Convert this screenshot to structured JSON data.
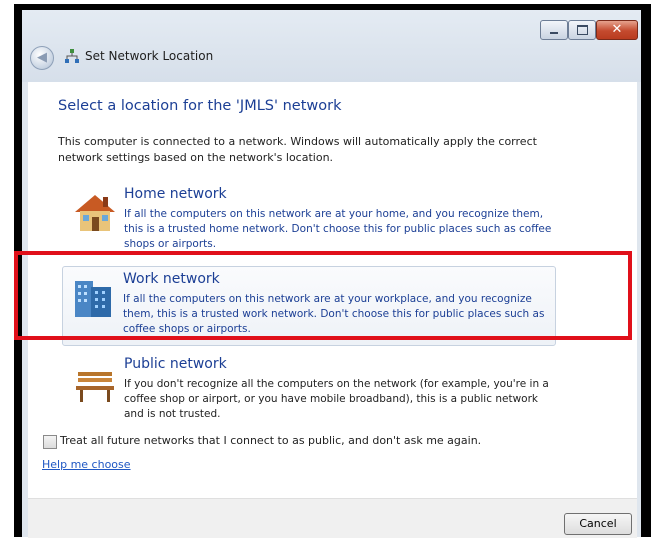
{
  "window": {
    "title": "Set Network Location",
    "controls": {
      "minimize_icon": "minimize-icon",
      "maximize_icon": "maximize-icon",
      "close_icon": "close-icon"
    }
  },
  "main": {
    "heading": "Select a location for the 'JMLS' network",
    "intro": "This computer is connected to a network. Windows will automatically apply the correct network settings based on the network's location.",
    "options": [
      {
        "title": "Home network",
        "description": "If all the computers on this network are at your home, and you recognize them, this is a trusted home network.  Don't choose this for public places such as coffee shops or airports.",
        "icon": "house-icon"
      },
      {
        "title": "Work network",
        "description": "If all the computers on this network are at your workplace, and you recognize them, this is a trusted work network.  Don't choose this for public places such as coffee shops or airports.",
        "icon": "office-building-icon",
        "selected": true
      },
      {
        "title": "Public network",
        "description": "If you don't recognize all the computers on the network (for example, you're in a coffee shop or airport, or you have mobile broadband), this is a public network and is not trusted.",
        "icon": "park-bench-icon"
      }
    ],
    "checkbox_label": "Treat all future networks that I connect to as public, and don't ask me again.",
    "checkbox_checked": false,
    "help_link": "Help me choose"
  },
  "footer": {
    "cancel_label": "Cancel"
  },
  "colors": {
    "link": "#1c3f95",
    "highlight_border": "#e0101a"
  }
}
